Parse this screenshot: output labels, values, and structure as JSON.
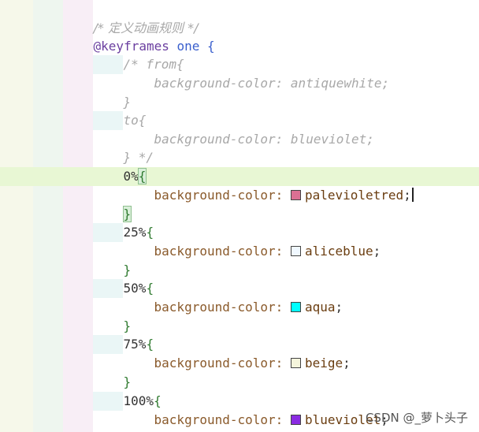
{
  "code": {
    "comment_header": "/* 定义动画规则 */",
    "keyframes_at": "@keyframes",
    "keyframes_name": "one",
    "open_brace": "{",
    "close_brace": "}",
    "comment_from": "/* from{",
    "comment_from_decl": "background-color: antiquewhite;",
    "comment_from_close": "}",
    "comment_to": "to{",
    "comment_to_decl": "background-color: blueviolet;",
    "comment_end": "} */",
    "property": "background-color:",
    "keyframes": [
      {
        "selector": "0%",
        "value": "palevioletred",
        "swatch": "#db7093"
      },
      {
        "selector": "25%",
        "value": "aliceblue",
        "swatch": "#f0f8ff"
      },
      {
        "selector": "50%",
        "value": "aqua",
        "swatch": "#00ffff"
      },
      {
        "selector": "75%",
        "value": "beige",
        "swatch": "#f5f5dc"
      },
      {
        "selector": "100%",
        "value": "blueviolet",
        "swatch": "#8a2be2"
      }
    ],
    "semicolon": ";"
  },
  "watermark": "CSDN @_萝卜头子"
}
